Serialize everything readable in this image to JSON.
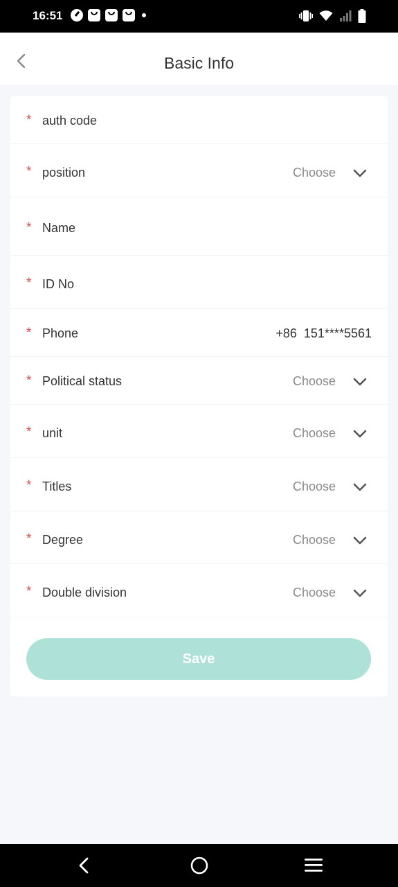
{
  "status_bar": {
    "time": "16:51",
    "notification_icons": [
      "speedometer-icon",
      "bag-icon",
      "bag-icon",
      "bag-icon"
    ],
    "system_icons": [
      "vibrate-icon",
      "wifi-icon",
      "signal-icon",
      "battery-icon"
    ]
  },
  "header": {
    "title": "Basic Info",
    "back_icon": "chevron-left-icon"
  },
  "form": {
    "fields": [
      {
        "label": "auth code",
        "required": true,
        "type": "text"
      },
      {
        "label": "position",
        "required": true,
        "type": "select",
        "placeholder": "Choose"
      },
      {
        "label": "Name",
        "required": true,
        "type": "text"
      },
      {
        "label": "ID No",
        "required": true,
        "type": "text"
      },
      {
        "label": "Phone",
        "required": true,
        "type": "phone",
        "value": "+86  151****5561"
      },
      {
        "label": "Political status",
        "required": true,
        "type": "select",
        "placeholder": "Choose"
      },
      {
        "label": "unit",
        "required": true,
        "type": "select",
        "placeholder": "Choose"
      },
      {
        "label": "Titles",
        "required": true,
        "type": "select",
        "placeholder": "Choose"
      },
      {
        "label": "Degree",
        "required": true,
        "type": "select",
        "placeholder": "Choose"
      },
      {
        "label": "Double division",
        "required": true,
        "type": "select",
        "placeholder": "Choose"
      }
    ],
    "required_mark": "*",
    "save_label": "Save"
  },
  "nav_bar": {
    "icons": [
      "nav-back-icon",
      "nav-home-icon",
      "nav-menu-icon"
    ]
  },
  "colors": {
    "required": "#e5484d",
    "save_button_disabled": "#aee2d9",
    "background": "#f5f7fa"
  }
}
